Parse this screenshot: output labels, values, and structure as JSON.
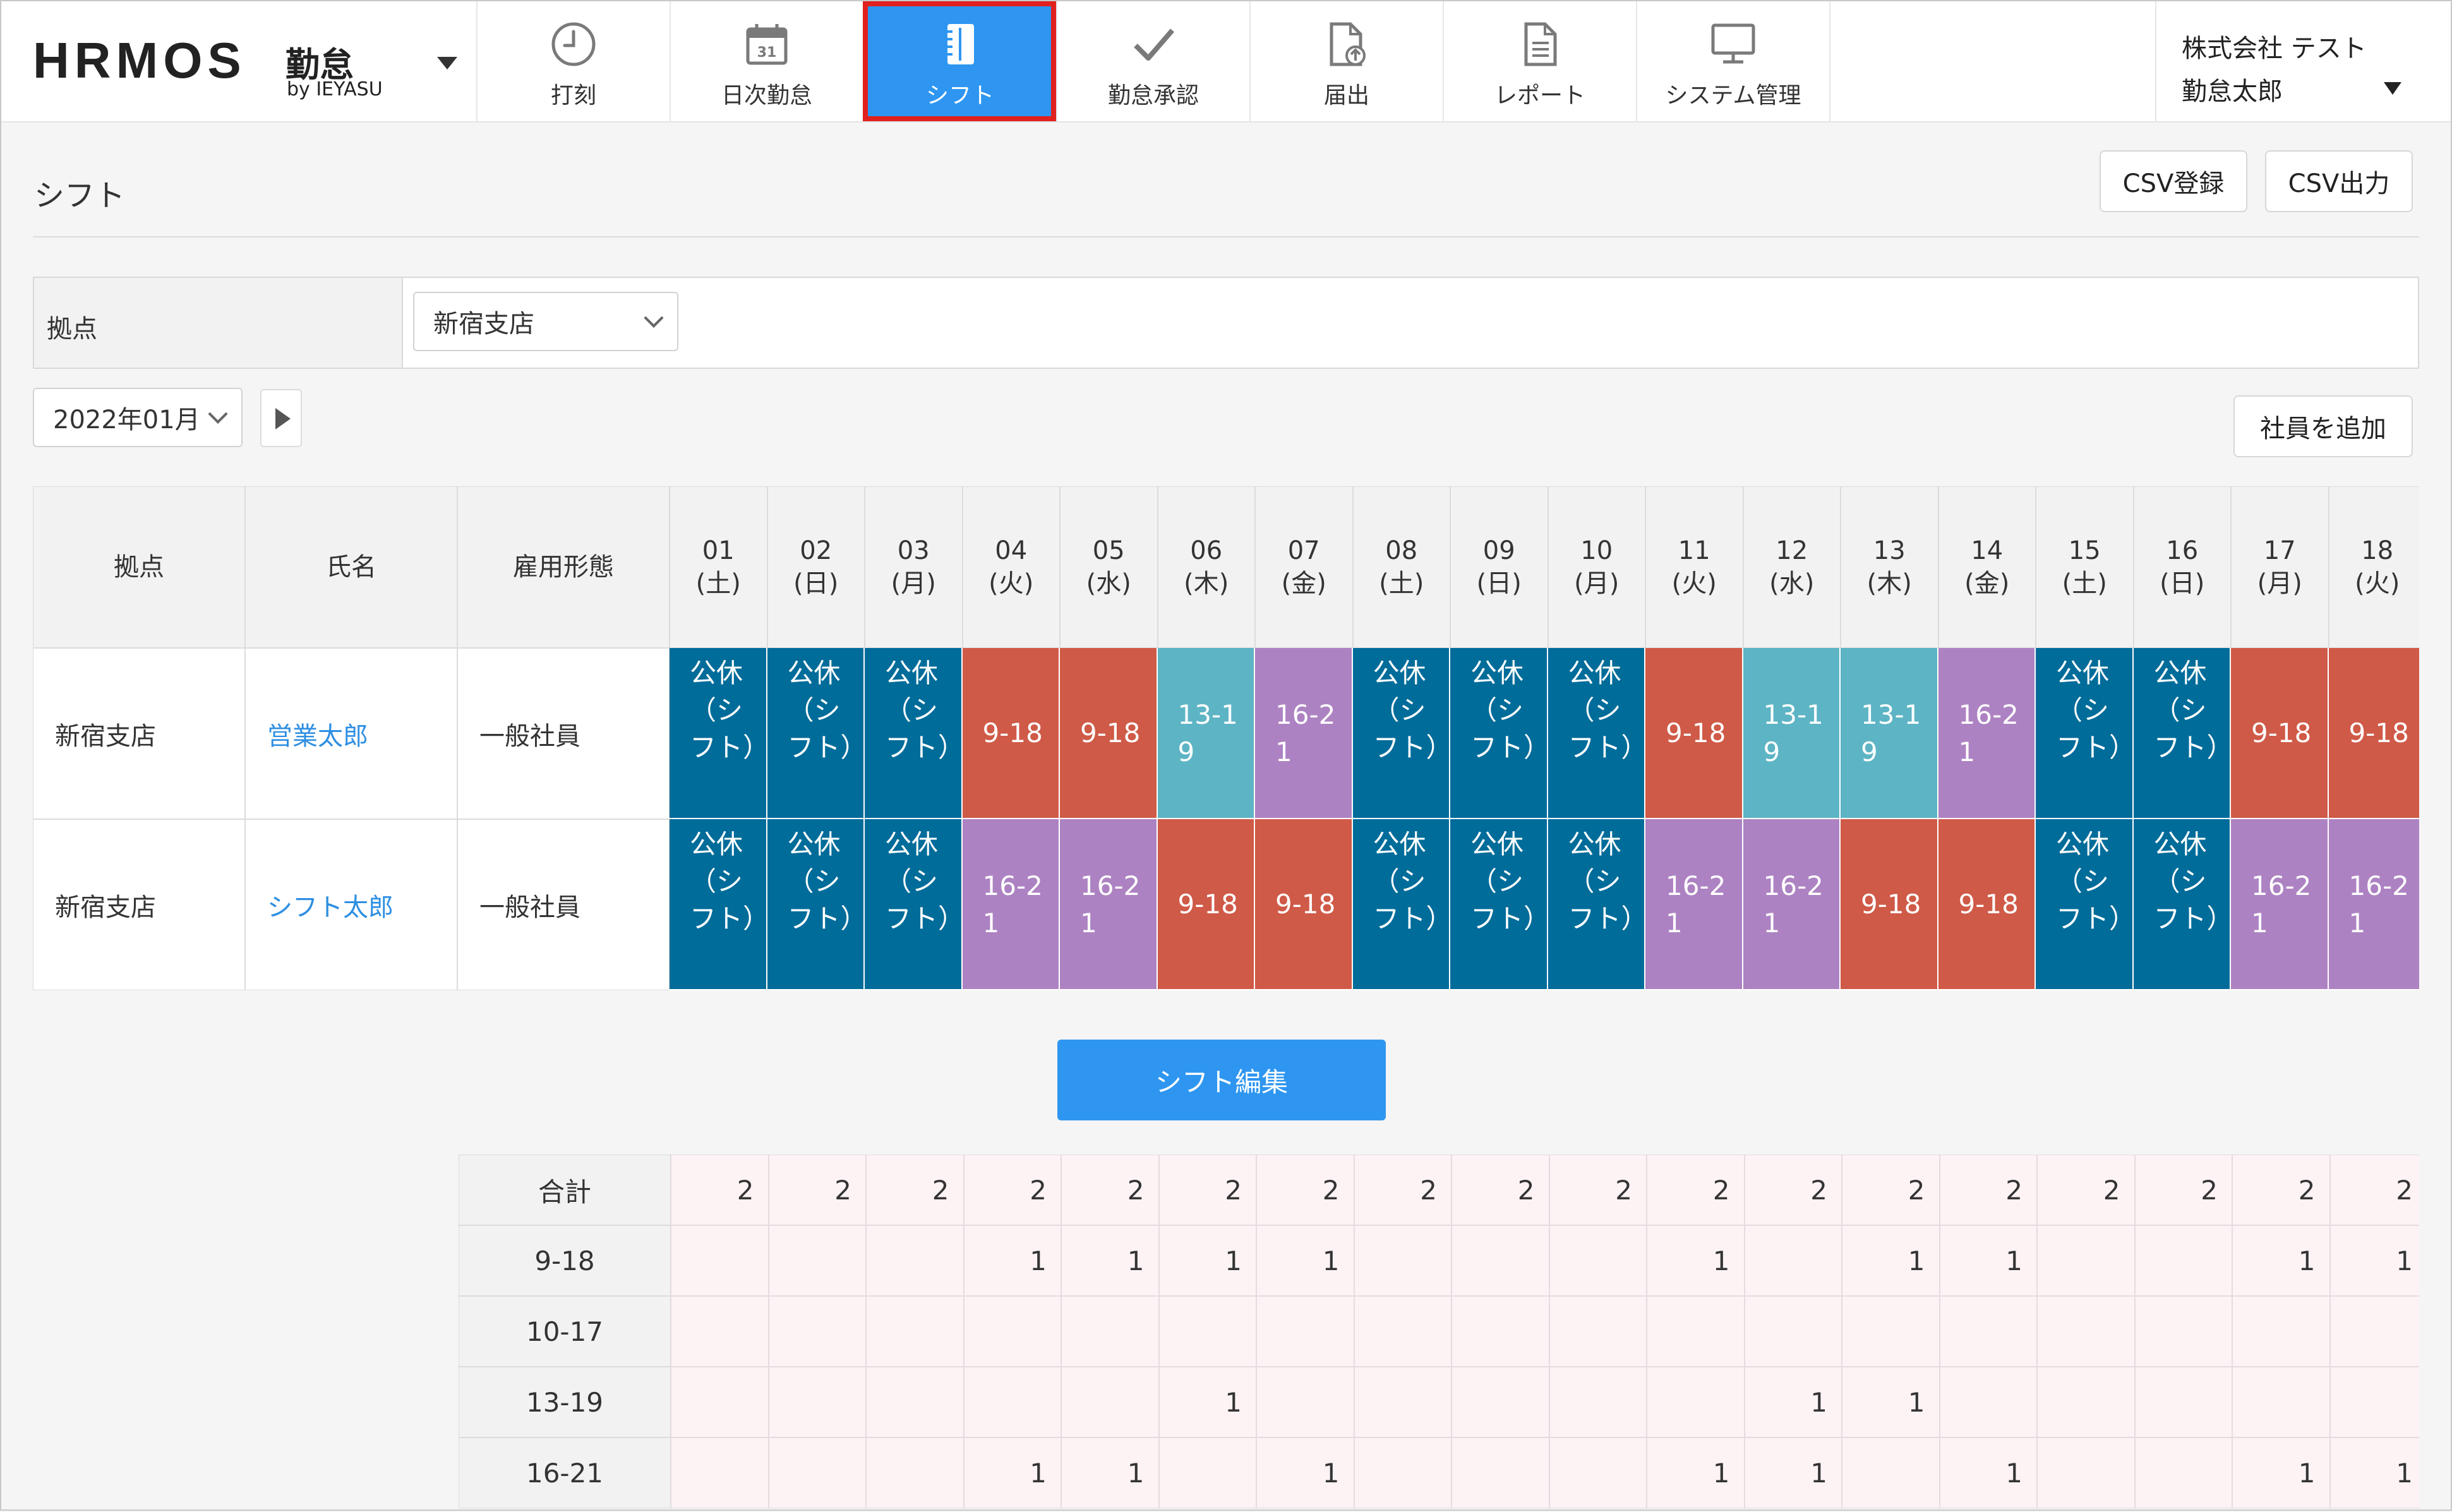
{
  "app": {
    "logo_main": "HRMOS",
    "logo_product": "勤怠",
    "logo_by": "by IEYASU"
  },
  "nav": [
    {
      "label": "打刻",
      "icon": "clock-icon",
      "active": false
    },
    {
      "label": "日次勤怠",
      "icon": "calendar-icon",
      "active": false
    },
    {
      "label": "シフト",
      "icon": "notebook-icon",
      "active": true
    },
    {
      "label": "勤怠承認",
      "icon": "checkmark-icon",
      "active": false
    },
    {
      "label": "届出",
      "icon": "document-upload-icon",
      "active": false
    },
    {
      "label": "レポート",
      "icon": "report-document-icon",
      "active": false
    },
    {
      "label": "システム管理",
      "icon": "monitor-icon",
      "active": false
    }
  ],
  "user": {
    "company": "株式会社 テスト",
    "name": "勤怠太郎"
  },
  "page": {
    "title": "シフト",
    "csv_import": "CSV登録",
    "csv_export": "CSV出力",
    "add_employee": "社員を追加",
    "edit_shift": "シフト編集"
  },
  "filter": {
    "label": "拠点",
    "value": "新宿支店"
  },
  "month": {
    "value": "2022年01月"
  },
  "table": {
    "headers": {
      "site": "拠点",
      "name": "氏名",
      "employment": "雇用形態"
    },
    "days": [
      {
        "d": "01",
        "w": "(土)"
      },
      {
        "d": "02",
        "w": "(日)"
      },
      {
        "d": "03",
        "w": "(月)"
      },
      {
        "d": "04",
        "w": "(火)"
      },
      {
        "d": "05",
        "w": "(水)"
      },
      {
        "d": "06",
        "w": "(木)"
      },
      {
        "d": "07",
        "w": "(金)"
      },
      {
        "d": "08",
        "w": "(土)"
      },
      {
        "d": "09",
        "w": "(日)"
      },
      {
        "d": "10",
        "w": "(月)"
      },
      {
        "d": "11",
        "w": "(火)"
      },
      {
        "d": "12",
        "w": "(水)"
      },
      {
        "d": "13",
        "w": "(木)"
      },
      {
        "d": "14",
        "w": "(金)"
      },
      {
        "d": "15",
        "w": "(土)"
      },
      {
        "d": "16",
        "w": "(日)"
      },
      {
        "d": "17",
        "w": "(月)"
      },
      {
        "d": "18",
        "w": "(火)"
      }
    ],
    "rows": [
      {
        "site": "新宿支店",
        "name": "営業太郎",
        "employment": "一般社員",
        "shifts": [
          "公休（シフト）",
          "公休（シフト）",
          "公休（シフト）",
          "9-18",
          "9-18",
          "13-19",
          "16-21",
          "公休（シフト）",
          "公休（シフト）",
          "公休（シフト）",
          "9-18",
          "13-19",
          "13-19",
          "16-21",
          "公休（シフト）",
          "公休（シフト）",
          "9-18",
          "9-18"
        ]
      },
      {
        "site": "新宿支店",
        "name": "シフト太郎",
        "employment": "一般社員",
        "shifts": [
          "公休（シフト）",
          "公休（シフト）",
          "公休（シフト）",
          "16-21",
          "16-21",
          "9-18",
          "9-18",
          "公休（シフト）",
          "公休（シフト）",
          "公休（シフト）",
          "16-21",
          "16-21",
          "9-18",
          "9-18",
          "公休（シフト）",
          "公休（シフト）",
          "16-21",
          "16-21"
        ]
      }
    ]
  },
  "shift_colors": {
    "公休（シフト）": "#006c9a",
    "9-18": "#cf5a47",
    "13-19": "#5db4c4",
    "16-21": "#ad82c2"
  },
  "summary": {
    "rows": [
      {
        "label": "合計",
        "values": [
          "2",
          "2",
          "2",
          "2",
          "2",
          "2",
          "2",
          "2",
          "2",
          "2",
          "2",
          "2",
          "2",
          "2",
          "2",
          "2",
          "2",
          "2"
        ]
      },
      {
        "label": "9-18",
        "values": [
          "",
          "",
          "",
          "1",
          "1",
          "1",
          "1",
          "",
          "",
          "",
          "1",
          "",
          "1",
          "1",
          "",
          "",
          "1",
          "1"
        ]
      },
      {
        "label": "10-17",
        "values": [
          "",
          "",
          "",
          "",
          "",
          "",
          "",
          "",
          "",
          "",
          "",
          "",
          "",
          "",
          "",
          "",
          "",
          ""
        ]
      },
      {
        "label": "13-19",
        "values": [
          "",
          "",
          "",
          "",
          "",
          "1",
          "",
          "",
          "",
          "",
          "",
          "1",
          "1",
          "",
          "",
          "",
          "",
          ""
        ]
      },
      {
        "label": "16-21",
        "values": [
          "",
          "",
          "",
          "1",
          "1",
          "",
          "1",
          "",
          "",
          "",
          "1",
          "1",
          "",
          "1",
          "",
          "",
          "1",
          "1"
        ]
      }
    ]
  }
}
